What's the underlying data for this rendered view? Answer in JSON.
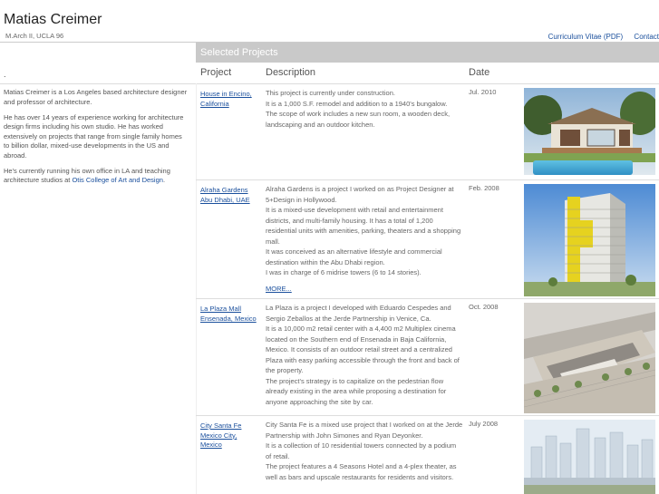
{
  "header": {
    "name": "Matias Creimer",
    "subtitle": "M.Arch II, UCLA 96",
    "links": [
      "Curriculum Vitae (PDF)",
      "Contact"
    ]
  },
  "section_title": "Selected Projects",
  "sidebar": {
    "marker": ".",
    "bio": [
      "Matias Creimer is a Los Angeles based architecture designer and professor of architecture.",
      "He has over 14 years of experience working for architecture design firms including his own studio. He has worked extensively on projects that range from single family homes to billion dollar, mixed-use developments in the US and abroad.",
      "He's currently running his own office in LA and teaching architecture studios at"
    ],
    "bio_link": "Otis College of Art and Design",
    "bio_end": "."
  },
  "columns": [
    "Project",
    "Description",
    "Date"
  ],
  "projects": [
    {
      "name": "House in Encino, California",
      "date": "Jul. 2010",
      "desc": [
        "This project is currently under construction.",
        "It is a 1,000 S.F. remodel and addition to a 1940's bungalow.",
        "The scope of work includes a new sun room, a wooden deck, landscaping and an outdoor kitchen."
      ],
      "more": ""
    },
    {
      "name": "Alraha Gardens Abu Dhabi, UAE",
      "date": "Feb. 2008",
      "desc": [
        "Alraha Gardens is a project I worked on as Project Designer at 5+Design in Hollywood.",
        "It is a mixed-use development with retail and entertainment districts, and multi-family housing. It has a total of 1,200 residential units with amenities, parking, theaters and a shopping mall.",
        "It was conceived as an alternative lifestyle and commercial destination within the Abu Dhabi region.",
        "I was in charge of 6 midrise towers (6 to 14 stories)."
      ],
      "more": "MORE..."
    },
    {
      "name": "La Plaza Mall Ensenada, Mexico",
      "date": "Oct. 2008",
      "desc": [
        "La Plaza is a project I developed with Eduardo Cespedes and Sergio Zeballos at the Jerde Partnership in Venice, Ca.",
        "It is a 10,000 m2 retail center with a 4,400 m2 Multiplex cinema located on the Southern end of Ensenada in Baja California, Mexico. It consists of an outdoor retail street and a centralized Plaza with easy parking accessible through the front and back of the property.",
        "The project's strategy is to capitalize on the pedestrian flow already existing in the area while proposing a destination for anyone approaching the site by car."
      ],
      "more": ""
    },
    {
      "name": "City Santa Fe Mexico City, Mexico",
      "date": "July 2008",
      "desc": [
        "City Santa Fe is a mixed use project that I worked on at the Jerde Partnership with John Simones and Ryan Deyonker.",
        "It is a collection of 10 residential towers connected by a podium of retail.",
        "The project features a 4 Seasons Hotel and a 4-plex theater, as well as bars and upscale restaurants for residents and visitors."
      ],
      "more": ""
    }
  ]
}
